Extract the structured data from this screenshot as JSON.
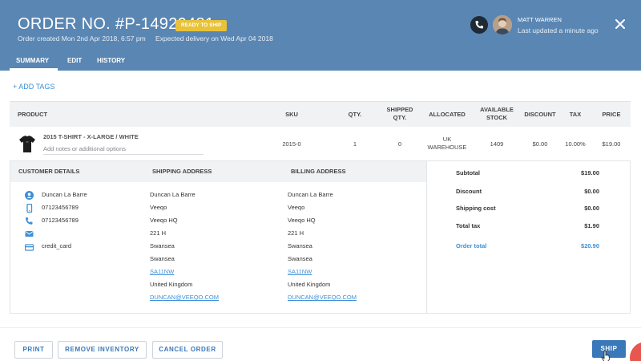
{
  "header": {
    "order_title": "ORDER NO. #P-14920481",
    "status_badge": "READY TO SHIP",
    "created": "Order created Mon 2nd Apr 2018, 6:57 pm",
    "expected": "Expected delivery on Wed Apr 04 2018",
    "user_name": "MATT WARREN",
    "user_updated": "Last updated a minute ago",
    "bg_color": "#5a86b3"
  },
  "tabs": [
    {
      "label": "SUMMARY",
      "active": true
    },
    {
      "label": "EDIT",
      "active": false
    },
    {
      "label": "HISTORY",
      "active": false
    }
  ],
  "add_tags": "+ ADD TAGS",
  "product_table": {
    "headers": {
      "product": "PRODUCT",
      "sku": "SKU",
      "qty": "QTY.",
      "shipped_qty_1": "SHIPPED",
      "shipped_qty_2": "QTY.",
      "allocated": "ALLOCATED",
      "available_stock_1": "AVAILABLE",
      "available_stock_2": "STOCK",
      "discount": "DISCOUNT",
      "tax": "TAX",
      "price": "PRICE"
    },
    "row": {
      "product_name": "2015 T-SHIRT - X-LARGE / WHITE",
      "notes_placeholder": "Add notes or additional options",
      "sku": "2015-0",
      "qty": "1",
      "shipped_qty": "0",
      "allocated_1": "UK",
      "allocated_2": "WAREHOUSE",
      "available_stock": "1409",
      "discount": "$0.00",
      "tax": "10.00%",
      "price": "$19.00"
    }
  },
  "details": {
    "customer_header": "CUSTOMER DETAILS",
    "shipping_header": "SHIPPING ADDRESS",
    "billing_header": "BILLING ADDRESS",
    "customer": {
      "name": "Duncan La Barre",
      "mobile": "07123456789",
      "phone": "07123456789",
      "email": "",
      "payment": "credit_card"
    },
    "shipping": [
      "Duncan La Barre",
      "Veeqo",
      "Veeqo HQ",
      "221 H",
      "Swansea",
      "Swansea",
      "SA11NW",
      "United Kingdom",
      "DUNCAN@VEEQO.COM"
    ],
    "billing": [
      "Duncan La Barre",
      "Veeqo",
      "Veeqo HQ",
      "221 H",
      "Swansea",
      "Swansea",
      "SA11NW",
      "United Kingdom",
      "DUNCAN@VEEQO.COM"
    ]
  },
  "summary": {
    "subtotal_label": "Subtotal",
    "subtotal": "$19.00",
    "discount_label": "Discount",
    "discount": "$0.00",
    "shipping_label": "Shipping cost",
    "shipping": "$0.00",
    "tax_label": "Total tax",
    "tax": "$1.90",
    "total_label": "Order total",
    "total": "$20.90"
  },
  "footer": {
    "print": "PRINT",
    "remove_inventory": "REMOVE INVENTORY",
    "cancel_order": "CANCEL ORDER",
    "ship": "SHIP"
  },
  "icons": {
    "phone": "phone-icon",
    "close": "close-icon",
    "user": "user-icon",
    "mobile": "mobile-icon",
    "email": "email-icon",
    "card": "credit-card-icon"
  },
  "colors": {
    "accent": "#3d8fd6",
    "badge": "#e8c23a",
    "ship_button": "#3a78b9"
  }
}
